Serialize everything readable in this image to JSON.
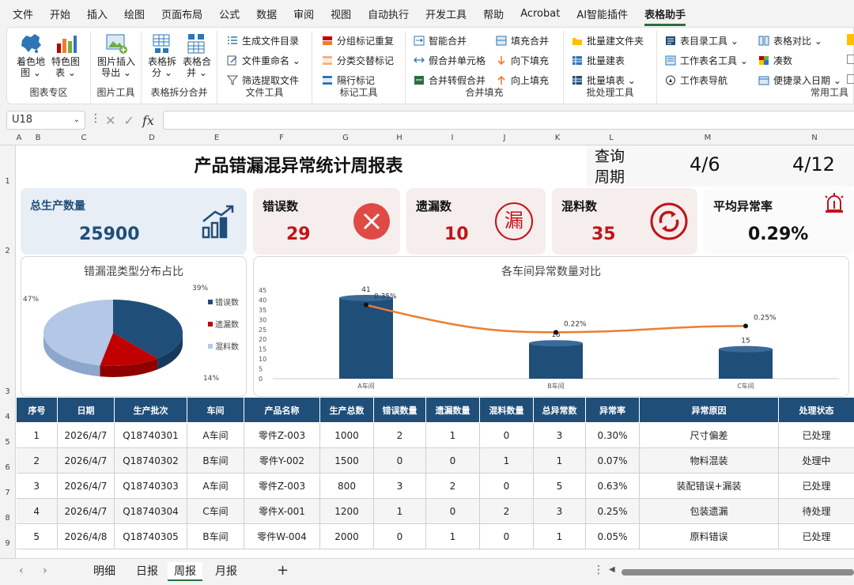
{
  "menu": [
    "文件",
    "开始",
    "插入",
    "绘图",
    "页面布局",
    "公式",
    "数据",
    "审阅",
    "视图",
    "自动执行",
    "开发工具",
    "帮助",
    "Acrobat",
    "AI智能插件",
    "表格助手"
  ],
  "ribbon": {
    "g1": {
      "label": "图表专区",
      "b1": "着色地\n图 ⌄",
      "b1a": "着色地",
      "b1b": "图 ⌄",
      "b2a": "特色图",
      "b2b": "表 ⌄"
    },
    "g2": {
      "label": "图片工具",
      "b1a": "图片插入",
      "b1b": "导出 ⌄"
    },
    "g3": {
      "label": "表格拆分合并",
      "b1a": "表格拆",
      "b1b": "分 ⌄",
      "b2a": "表格合",
      "b2b": "并 ⌄"
    },
    "g4": {
      "label": "文件工具",
      "s1": "生成文件目录",
      "s2": "文件重命名 ⌄",
      "s3": "筛选提取文件"
    },
    "g5": {
      "label": "标记工具",
      "s1": "分组标记重复",
      "s2": "分类交替标记",
      "s3": "隔行标记"
    },
    "g6": {
      "label": "合并填充",
      "s1": "智能合并",
      "s2": "假合并单元格",
      "s3": "合并转假合并",
      "s4": "填充合并",
      "s5": "向下填充",
      "s6": "向上填充"
    },
    "g7": {
      "label": "批处理工具",
      "s1": "批量建文件夹",
      "s2": "批量建表",
      "s3": "批量填表 ⌄"
    },
    "g8": {
      "label": "常用工具",
      "s1": "表目录工具 ⌄",
      "s2": "工作表名工具 ⌄",
      "s3": "工作表导航",
      "s4": "表格对比 ⌄",
      "s5": "凑数",
      "s6": "便捷录入日期 ⌄"
    }
  },
  "formula_bar": {
    "cell_ref": "U18",
    "fx": "fx",
    "value": ""
  },
  "columns": [
    "A",
    "B",
    "C",
    "D",
    "E",
    "F",
    "G",
    "H",
    "I",
    "J",
    "K",
    "L",
    "M",
    "N"
  ],
  "rows": [
    "1",
    "2",
    "3",
    "4",
    "5",
    "6",
    "7",
    "8",
    "9"
  ],
  "report": {
    "title": "产品错漏混异常统计周报表",
    "query_label_1": "查询",
    "query_label_2": "周期",
    "start_date": "4/6",
    "end_date": "4/12"
  },
  "kpis": {
    "total": {
      "label": "总生产数量",
      "value": "25900"
    },
    "error": {
      "label": "错误数",
      "value": "29"
    },
    "missing": {
      "label": "遗漏数",
      "value": "10",
      "icon_char": "漏"
    },
    "mixed": {
      "label": "混料数",
      "value": "35"
    },
    "rate": {
      "label": "平均异常率",
      "value": "0.29%"
    }
  },
  "colors": {
    "navy": "#1f4e79",
    "red": "#c0141b",
    "orange": "#ed7d31",
    "pie_blue": "#1f4e79",
    "pie_red": "#c00000",
    "pie_light": "#b4c7e7"
  },
  "chart_data": [
    {
      "type": "pie",
      "title": "错漏混类型分布占比",
      "categories": [
        "错误数",
        "遗漏数",
        "混料数"
      ],
      "values": [
        39,
        14,
        47
      ],
      "labels": [
        "39%",
        "14%",
        "47%"
      ],
      "legend_position": "right"
    },
    {
      "type": "bar",
      "title": "各车间异常数量对比",
      "categories": [
        "A车间",
        "B车间",
        "C车间"
      ],
      "series": [
        {
          "type": "bar",
          "values": [
            41,
            18,
            15
          ]
        },
        {
          "type": "line",
          "values": [
            0.35,
            0.22,
            0.25
          ],
          "labels": [
            "0.35%",
            "0.22%",
            "0.25%"
          ]
        }
      ],
      "y_ticks": [
        "0",
        "5",
        "10",
        "15",
        "20",
        "25",
        "30",
        "35",
        "40",
        "45"
      ],
      "ylim": [
        0,
        45
      ]
    }
  ],
  "table": {
    "headers": [
      "序号",
      "日期",
      "生产批次",
      "车间",
      "产品名称",
      "生产总数",
      "错误数量",
      "遗漏数量",
      "混料数量",
      "总异常数",
      "异常率",
      "异常原因",
      "处理状态"
    ],
    "rows": [
      [
        "1",
        "2026/4/7",
        "Q18740301",
        "A车间",
        "零件Z-003",
        "1000",
        "2",
        "1",
        "0",
        "3",
        "0.30%",
        "尺寸偏差",
        "已处理"
      ],
      [
        "2",
        "2026/4/7",
        "Q18740302",
        "B车间",
        "零件Y-002",
        "1500",
        "0",
        "0",
        "1",
        "1",
        "0.07%",
        "物料混装",
        "处理中"
      ],
      [
        "3",
        "2026/4/7",
        "Q18740303",
        "A车间",
        "零件Z-003",
        "800",
        "3",
        "2",
        "0",
        "5",
        "0.63%",
        "装配错误+漏装",
        "已处理"
      ],
      [
        "4",
        "2026/4/7",
        "Q18740304",
        "C车间",
        "零件X-001",
        "1200",
        "1",
        "0",
        "2",
        "3",
        "0.25%",
        "包装遗漏",
        "待处理"
      ],
      [
        "5",
        "2026/4/8",
        "Q18740305",
        "B车间",
        "零件W-004",
        "2000",
        "0",
        "1",
        "0",
        "1",
        "0.05%",
        "原料错误",
        "已处理"
      ]
    ]
  },
  "sheet_tabs": [
    "明细",
    "日报",
    "周报",
    "月报"
  ],
  "active_tab": "周报"
}
